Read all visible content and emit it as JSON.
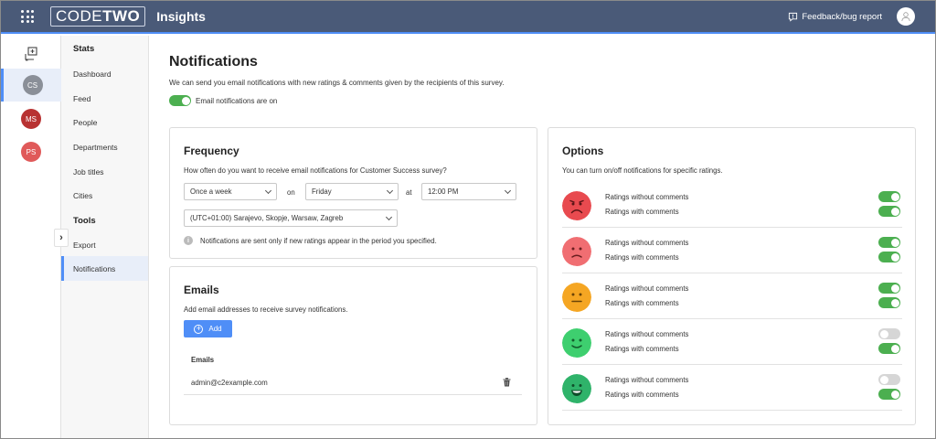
{
  "header": {
    "logo_part1": "CODE",
    "logo_part2": "TWO",
    "app_title": "Insights",
    "feedback_label": "Feedback/bug report"
  },
  "rail": {
    "avatars": [
      {
        "initials": "CS",
        "color": "#8a8f98"
      },
      {
        "initials": "MS",
        "color": "#b83232"
      },
      {
        "initials": "PS",
        "color": "#e05a5a"
      }
    ]
  },
  "nav": {
    "stats_heading": "Stats",
    "stats_items": [
      "Dashboard",
      "Feed",
      "People",
      "Departments",
      "Job titles",
      "Cities"
    ],
    "tools_heading": "Tools",
    "tools_items": [
      "Export",
      "Notifications"
    ]
  },
  "page": {
    "title": "Notifications",
    "subtitle": "We can send you email notifications with new ratings & comments given by the recipients of this survey.",
    "email_toggle_label": "Email notifications are on",
    "email_toggle_on": true
  },
  "frequency": {
    "title": "Frequency",
    "question": "How often do you want to receive email notifications for Customer Success survey?",
    "interval": "Once a week",
    "on_label": "on",
    "day": "Friday",
    "at_label": "at",
    "time": "12:00 PM",
    "timezone": "(UTC+01:00) Sarajevo, Skopje, Warsaw, Zagreb",
    "info": "Notifications are sent only if new ratings appear in the period you specified."
  },
  "emails": {
    "title": "Emails",
    "description": "Add email addresses to receive survey notifications.",
    "add_label": "Add",
    "column_header": "Emails",
    "rows": [
      "admin@c2example.com"
    ]
  },
  "options": {
    "title": "Options",
    "description": "You can turn on/off notifications for specific ratings.",
    "without_label": "Ratings without comments",
    "with_label": "Ratings with comments",
    "ratings": [
      {
        "face": "very-sad-face-icon",
        "color": "#e84a4f",
        "without_on": true,
        "with_on": true
      },
      {
        "face": "sad-face-icon",
        "color": "#f06e72",
        "without_on": true,
        "with_on": true
      },
      {
        "face": "neutral-face-icon",
        "color": "#f5a623",
        "without_on": true,
        "with_on": true
      },
      {
        "face": "smile-face-icon",
        "color": "#3ecf6f",
        "without_on": false,
        "with_on": true
      },
      {
        "face": "happy-face-icon",
        "color": "#2fb36a",
        "without_on": false,
        "with_on": true
      }
    ]
  }
}
